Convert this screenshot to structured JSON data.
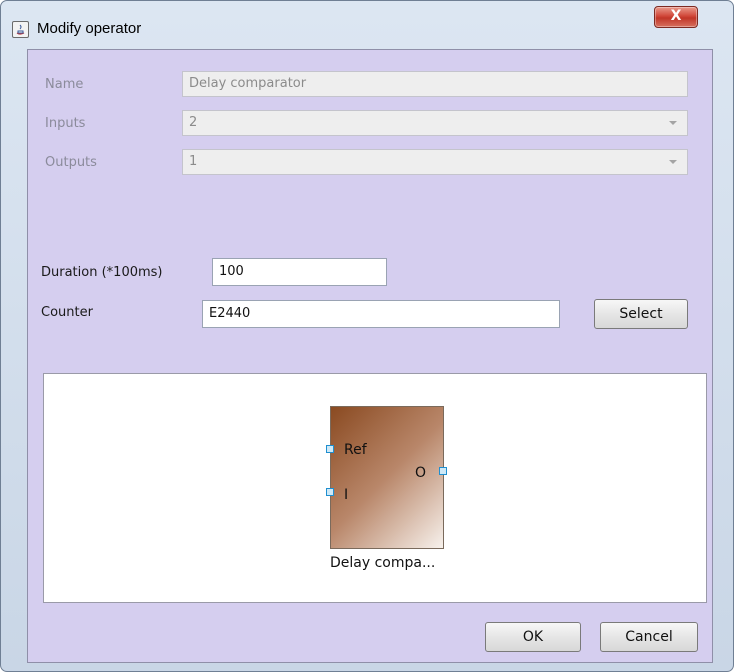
{
  "window": {
    "title": "Modify operator",
    "close_glyph": "X",
    "app_icon": "java-icon"
  },
  "form": {
    "name": {
      "label": "Name",
      "value": "Delay comparator"
    },
    "inputs": {
      "label": "Inputs",
      "value": "2"
    },
    "outputs": {
      "label": "Outputs",
      "value": "1"
    },
    "duration": {
      "label": "Duration (*100ms)",
      "value": "100"
    },
    "counter": {
      "label": "Counter",
      "value": "E2440"
    },
    "select_label": "Select"
  },
  "preview": {
    "ref_label": "Ref",
    "input_label": "I",
    "output_label": "O",
    "caption": "Delay compa..."
  },
  "footer": {
    "ok_label": "OK",
    "cancel_label": "Cancel"
  },
  "colors": {
    "content_bg": "#d5ceef",
    "block_dark": "#8a4a21",
    "close_red": "#c13628"
  }
}
